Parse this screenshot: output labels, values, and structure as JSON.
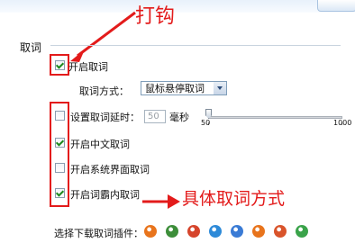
{
  "annotations": {
    "check_note": "打钩",
    "method_note": "具体取词方式",
    "color": "#e31b1b"
  },
  "section": {
    "title": "取词"
  },
  "options": {
    "enable_lookup": {
      "label": "开启取词",
      "checked": true
    },
    "lookup_method": {
      "label": "取词方式：",
      "value": "鼠标悬停取词"
    },
    "lookup_delay": {
      "label": "设置取词延时：",
      "checked": false,
      "value": "50",
      "unit": "毫秒",
      "min_label": "50",
      "max_label": "1000",
      "slider_level": 0
    },
    "chinese_lookup": {
      "label": "开启中文取词",
      "checked": true
    },
    "system_ui_lookup": {
      "label": "开启系统界面取词",
      "checked": false
    },
    "pdf_lookup": {
      "label": "开启词霸内取词",
      "checked": true
    }
  },
  "plugins": {
    "label": "选择下载取词插件：",
    "icons": [
      {
        "name": "firefox-icon",
        "color": "#e8741c"
      },
      {
        "name": "chrome-icon",
        "color": "#3d8e3a"
      },
      {
        "name": "chrome-alt-icon",
        "color": "#d6452c"
      },
      {
        "name": "browser360-icon",
        "color": "#2e8ad8"
      },
      {
        "name": "maxthon-icon",
        "color": "#3a7bd5"
      },
      {
        "name": "sogou-icon",
        "color": "#e8741c"
      },
      {
        "name": "liebao-icon",
        "color": "#d9542b"
      },
      {
        "name": "qq-browser-icon",
        "color": "#3aa34a"
      }
    ]
  }
}
